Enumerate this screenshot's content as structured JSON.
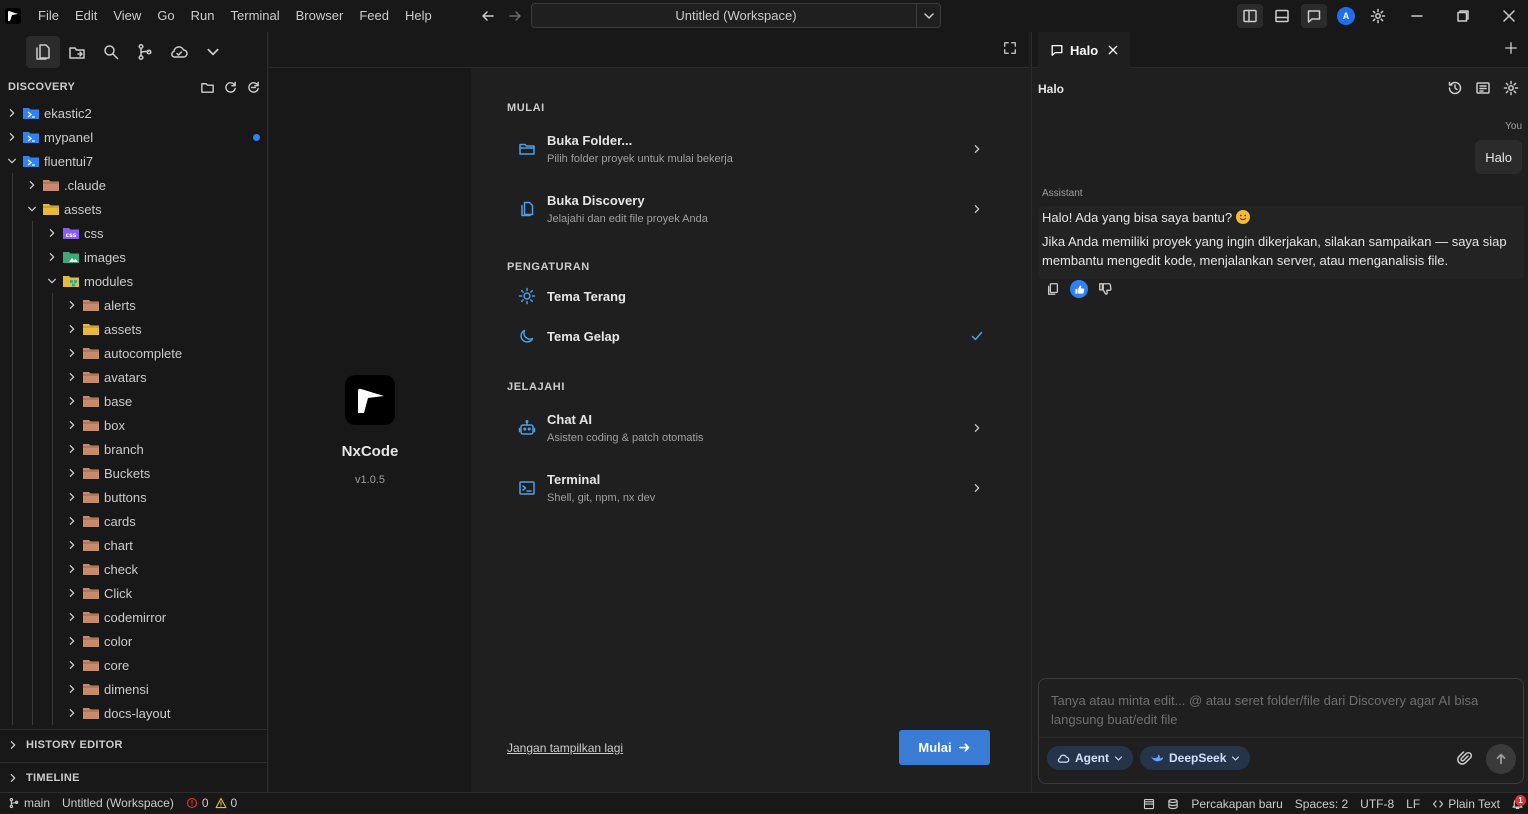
{
  "menu": [
    "File",
    "Edit",
    "View",
    "Go",
    "Run",
    "Terminal",
    "Browser",
    "Feed",
    "Help"
  ],
  "command_center": {
    "label": "Untitled (Workspace)"
  },
  "account": {
    "initial": "A"
  },
  "sidebar": {
    "title": "DISCOVERY",
    "tree": [
      {
        "label": "ekastic2",
        "depth": 0,
        "expanded": false,
        "type": "workspace"
      },
      {
        "label": "mypanel",
        "depth": 0,
        "expanded": false,
        "type": "workspace",
        "modified": true
      },
      {
        "label": "fluentui7",
        "depth": 0,
        "expanded": true,
        "type": "workspace"
      },
      {
        "label": ".claude",
        "depth": 1,
        "expanded": false,
        "type": "folder"
      },
      {
        "label": "assets",
        "depth": 1,
        "expanded": true,
        "type": "folder-yellow"
      },
      {
        "label": "css",
        "depth": 2,
        "expanded": false,
        "type": "css"
      },
      {
        "label": "images",
        "depth": 2,
        "expanded": false,
        "type": "images"
      },
      {
        "label": "modules",
        "depth": 2,
        "expanded": true,
        "type": "modules"
      },
      {
        "label": "alerts",
        "depth": 3,
        "expanded": false,
        "type": "folder"
      },
      {
        "label": "assets",
        "depth": 3,
        "expanded": false,
        "type": "folder-yellow"
      },
      {
        "label": "autocomplete",
        "depth": 3,
        "expanded": false,
        "type": "folder"
      },
      {
        "label": "avatars",
        "depth": 3,
        "expanded": false,
        "type": "folder"
      },
      {
        "label": "base",
        "depth": 3,
        "expanded": false,
        "type": "folder"
      },
      {
        "label": "box",
        "depth": 3,
        "expanded": false,
        "type": "folder"
      },
      {
        "label": "branch",
        "depth": 3,
        "expanded": false,
        "type": "folder"
      },
      {
        "label": "Buckets",
        "depth": 3,
        "expanded": false,
        "type": "folder"
      },
      {
        "label": "buttons",
        "depth": 3,
        "expanded": false,
        "type": "folder"
      },
      {
        "label": "cards",
        "depth": 3,
        "expanded": false,
        "type": "folder"
      },
      {
        "label": "chart",
        "depth": 3,
        "expanded": false,
        "type": "folder"
      },
      {
        "label": "check",
        "depth": 3,
        "expanded": false,
        "type": "folder"
      },
      {
        "label": "Click",
        "depth": 3,
        "expanded": false,
        "type": "folder"
      },
      {
        "label": "codemirror",
        "depth": 3,
        "expanded": false,
        "type": "folder"
      },
      {
        "label": "color",
        "depth": 3,
        "expanded": false,
        "type": "folder"
      },
      {
        "label": "core",
        "depth": 3,
        "expanded": false,
        "type": "folder"
      },
      {
        "label": "dimensi",
        "depth": 3,
        "expanded": false,
        "type": "folder"
      },
      {
        "label": "docs-layout",
        "depth": 3,
        "expanded": false,
        "type": "folder"
      }
    ],
    "history_editor": "HISTORY EDITOR",
    "timeline": "TIMELINE"
  },
  "welcome": {
    "app_name": "NxCode",
    "version": "v1.0.5",
    "sections": {
      "start": "MULAI",
      "settings": "PENGATURAN",
      "explore": "JELAJAHI"
    },
    "open_folder": {
      "title": "Buka Folder...",
      "desc": "Pilih folder proyek untuk mulai bekerja"
    },
    "open_discovery": {
      "title": "Buka Discovery",
      "desc": "Jelajahi dan edit file proyek Anda"
    },
    "theme_light": {
      "title": "Tema Terang"
    },
    "theme_dark": {
      "title": "Tema Gelap",
      "selected": true
    },
    "chat_ai": {
      "title": "Chat AI",
      "desc": "Asisten coding & patch otomatis"
    },
    "terminal": {
      "title": "Terminal",
      "desc": "Shell, git, npm, nx dev"
    },
    "dont_show": "Jangan tampilkan lagi",
    "start_button": "Mulai"
  },
  "chat": {
    "tab_label": "Halo",
    "title": "Halo",
    "user_label": "You",
    "user_message": "Halo",
    "assistant_label": "Assistant",
    "assistant_line1": "Halo! Ada yang bisa saya bantu?",
    "assistant_line2": "Jika Anda memiliki proyek yang ingin dikerjakan, silakan sampaikan — saya siap membantu mengedit kode, menjalankan server, atau menganalisis file.",
    "input_placeholder": "Tanya atau minta edit... @ atau seret folder/file dari Discovery agar AI bisa langsung buat/edit file",
    "mode": "Agent",
    "model": "DeepSeek"
  },
  "status": {
    "branch": "main",
    "workspace": "Untitled (Workspace)",
    "errors": "0",
    "warnings": "0",
    "new_chat": "Percakapan baru",
    "spaces": "Spaces: 2",
    "encoding": "UTF-8",
    "eol": "LF",
    "language": "Plain Text",
    "notifications": "1"
  },
  "colors": {
    "accent": "#3a7bd5",
    "link_icon": "#4d9fe8",
    "badge": "#e5302f"
  }
}
